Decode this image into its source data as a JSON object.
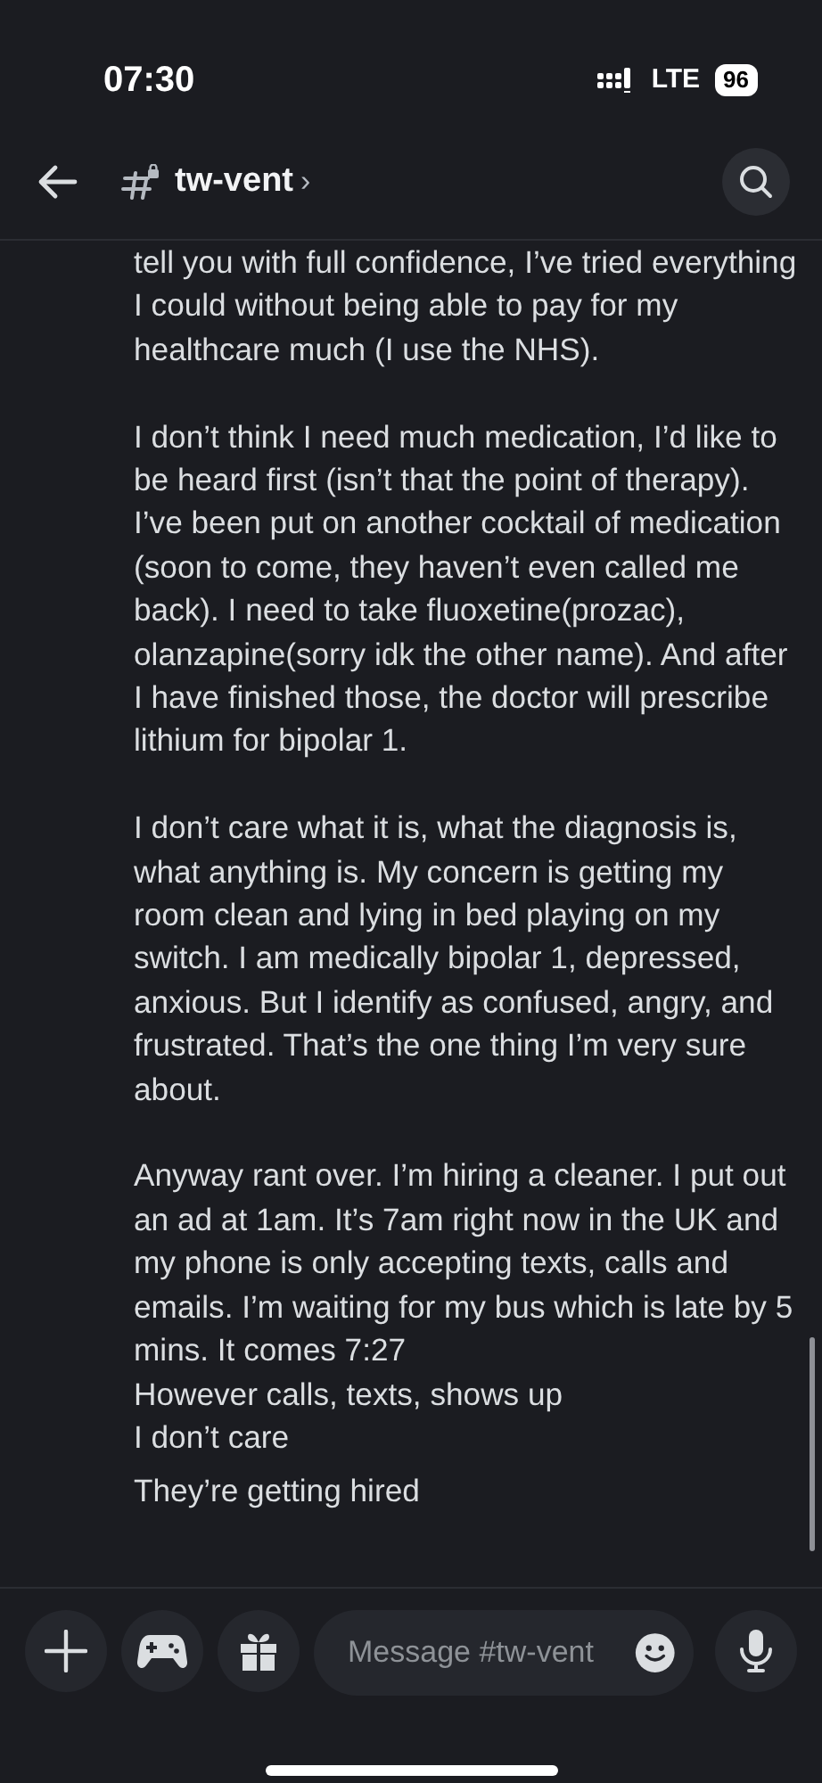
{
  "status_bar": {
    "time": "07:30",
    "network": "LTE",
    "battery": "96"
  },
  "header": {
    "channel": "tw-vent",
    "chevron": "›"
  },
  "messages": [
    {
      "paragraphs": [
        "tell you with full confidence, I’ve tried everything I could without being able to pay for my healthcare much (I use the NHS).",
        "I don’t think I need much medication, I’d like to be heard first (isn’t that the point of therapy). I’ve been put on another cocktail of medication (soon to come, they haven’t even called me back). I need to take fluoxetine(prozac), olanzapine(sorry idk the other name). And after I have finished those, the doctor will prescribe lithium for bipolar 1.",
        "I don’t care what it is, what the diagnosis is, what anything is. My concern is getting my room clean and lying in bed playing on my switch. I am medically bipolar 1, depressed, anxious. But I identify as confused, angry, and frustrated. That’s the one thing I’m very sure about.",
        "Anyway rant over. I’m hiring a cleaner. I put out an ad at 1am. It’s 7am right now in the UK and my phone is only accepting texts, calls and emails. I’m waiting for my bus which is late by 5 mins. It comes 7:27"
      ]
    },
    {
      "paragraphs": [
        "However calls, texts, shows up"
      ]
    },
    {
      "paragraphs": [
        "I don’t care"
      ]
    },
    {
      "paragraphs": [
        "They’re getting hired"
      ]
    }
  ],
  "composer": {
    "placeholder": "Message #tw-vent"
  }
}
